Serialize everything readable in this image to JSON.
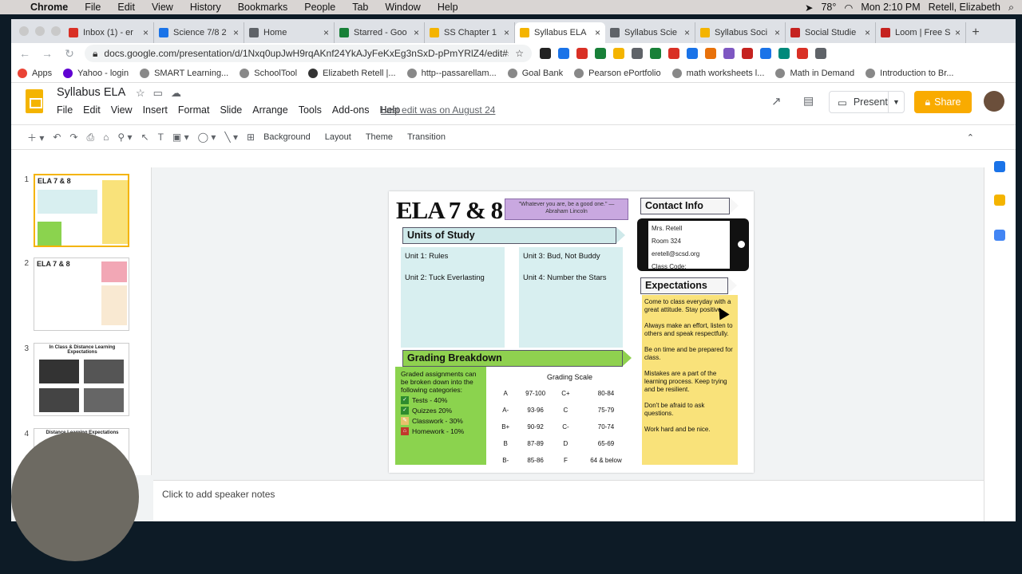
{
  "macos": {
    "app": "Chrome",
    "menus": [
      "File",
      "Edit",
      "View",
      "History",
      "Bookmarks",
      "People",
      "Tab",
      "Window",
      "Help"
    ],
    "temperature": "78°",
    "clock": "Mon 2:10 PM",
    "user": "Retell, Elizabeth"
  },
  "tabs": [
    {
      "label": "Inbox (1) - er",
      "color": "#d93025"
    },
    {
      "label": "Science 7/8 2",
      "color": "#1a73e8"
    },
    {
      "label": "Home",
      "color": "#5f6368"
    },
    {
      "label": "Starred - Goo",
      "color": "#188038"
    },
    {
      "label": "SS Chapter 1",
      "color": "#f4b400"
    },
    {
      "label": "Syllabus ELA",
      "color": "#f4b400",
      "active": true
    },
    {
      "label": "Syllabus Scie",
      "color": "#5f6368"
    },
    {
      "label": "Syllabus Soci",
      "color": "#f4b400"
    },
    {
      "label": "Social Studie",
      "color": "#c5221f"
    },
    {
      "label": "Loom | Free S",
      "color": "#c5221f"
    }
  ],
  "address": {
    "url": "docs.google.com/presentation/d/1Nxq0upJwH9rqAKnf24YkAJyFeKxEg3nSxD-pPmYRlZ4/edit#s..."
  },
  "bookmarks": [
    {
      "label": "Apps",
      "color": "#ea4335"
    },
    {
      "label": "Yahoo - login",
      "color": "#6001d2"
    },
    {
      "label": "SMART Learning...",
      "color": "#888"
    },
    {
      "label": "SchoolTool",
      "color": "#888"
    },
    {
      "label": "Elizabeth Retell |...",
      "color": "#333"
    },
    {
      "label": "http--passarellam...",
      "color": "#888"
    },
    {
      "label": "Goal Bank",
      "color": "#888"
    },
    {
      "label": "Pearson ePortfolio",
      "color": "#888"
    },
    {
      "label": "math worksheets l...",
      "color": "#888"
    },
    {
      "label": "Math in Demand",
      "color": "#888"
    },
    {
      "label": "Introduction to Br...",
      "color": "#888"
    }
  ],
  "doc": {
    "title": "Syllabus ELA",
    "menus": [
      "File",
      "Edit",
      "View",
      "Insert",
      "Format",
      "Slide",
      "Arrange",
      "Tools",
      "Add-ons",
      "Help"
    ],
    "last_edit": "Last edit was on August 24",
    "present": "Present",
    "share": "Share"
  },
  "toolbar": {
    "background": "Background",
    "layout": "Layout",
    "theme": "Theme",
    "transition": "Transition"
  },
  "thumbnails": [
    {
      "num": "1",
      "caption": "ELA 7 & 8"
    },
    {
      "num": "2",
      "caption": "ELA 7 & 8"
    },
    {
      "num": "3",
      "caption": "In Class & Distance Learning Expectations"
    },
    {
      "num": "4",
      "caption": "Distance Learning Expectations"
    }
  ],
  "slide": {
    "title": "ELA 7 & 8",
    "quote": "\"Whatever you are, be a good one.\" — Abraham Lincoln",
    "units_heading": "Units of Study",
    "units": [
      "Unit 1: Rules",
      "Unit 2: Tuck Everlasting",
      "Unit 3: Bud, Not Buddy",
      "Unit 4: Number the Stars"
    ],
    "contact_heading": "Contact Info",
    "contact": [
      "Mrs. Retell",
      "Room 324",
      "eretell@scsd.org",
      "Class Code:"
    ],
    "expectations_heading": "Expectations",
    "expectations": [
      "Come to class everyday with a great attitude. Stay positive.",
      "Always make an effort, listen to others and speak respectfully.",
      "Be on time and be prepared for class.",
      "Mistakes are a part of the learning process. Keep trying and be resilient.",
      "Don't be afraid to ask questions.",
      "Work hard and be nice."
    ],
    "grading_heading": "Grading Breakdown",
    "grading_intro": "Graded assignments can be broken down into the following categories:",
    "grading_items": [
      "Tests - 40%",
      "Quizzes 20%",
      "Classwork - 30%",
      "Homework - 10%"
    ],
    "scale_title": "Grading Scale",
    "scale": [
      [
        "A",
        "97-100",
        "C+",
        "80-84"
      ],
      [
        "A-",
        "93-96",
        "C",
        "75-79"
      ],
      [
        "B+",
        "90-92",
        "C-",
        "70-74"
      ],
      [
        "B",
        "87-89",
        "D",
        "65-69"
      ],
      [
        "B-",
        "85-86",
        "F",
        "64 & below"
      ]
    ]
  },
  "notes_placeholder": "Click to add speaker notes"
}
